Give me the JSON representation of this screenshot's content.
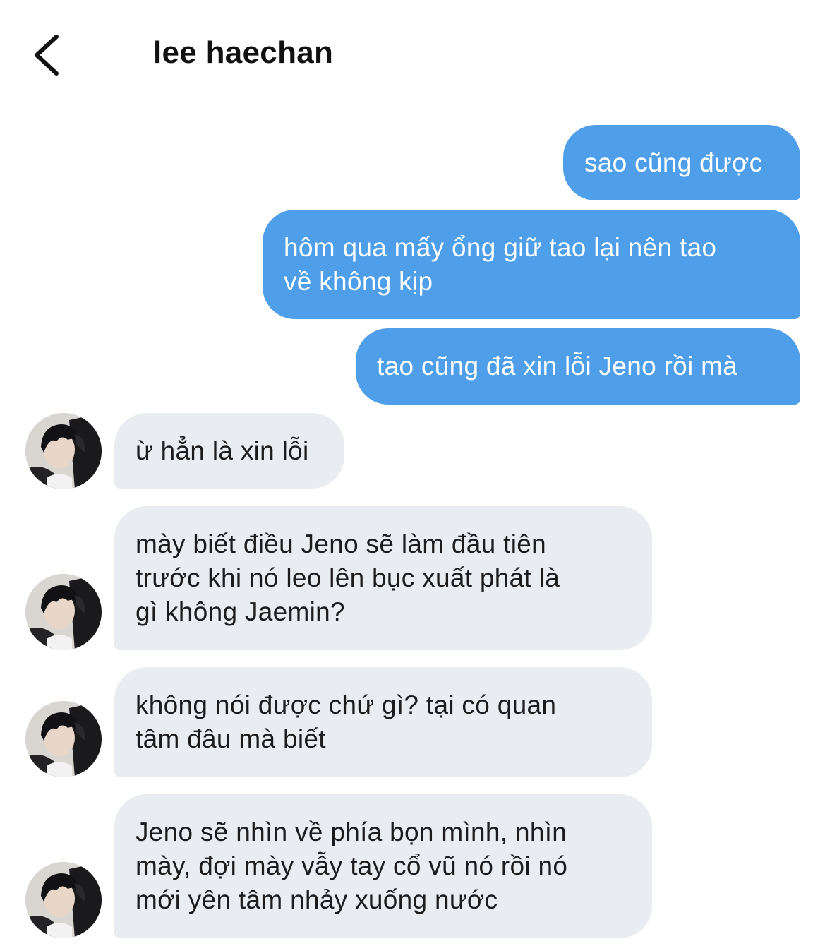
{
  "header": {
    "title": "lee haechan",
    "back_icon": "chevron-left-icon"
  },
  "colors": {
    "sent_bubble": "#4f9ee9",
    "received_bubble": "#e9ecf0",
    "sent_text": "#ffffff",
    "received_text": "#1c1c1e"
  },
  "messages": [
    {
      "direction": "sent",
      "text": "sao cũng được"
    },
    {
      "direction": "sent",
      "text": "hôm qua mấy ổng giữ tao lại nên tao\nvề không kịp"
    },
    {
      "direction": "sent",
      "text": "tao cũng đã xin lỗi Jeno rồi mà"
    },
    {
      "direction": "received",
      "text": "ừ hẳn là xin lỗi"
    },
    {
      "direction": "received",
      "text": "mày biết điều Jeno sẽ làm đầu tiên\ntrước khi nó leo lên bục xuất phát là\ngì không Jaemin?"
    },
    {
      "direction": "received",
      "text": "không nói được chứ gì? tại có quan\ntâm đâu mà biết"
    },
    {
      "direction": "received",
      "text": "Jeno sẽ nhìn về phía bọn mình, nhìn\nmày, đợi mày vẫy tay cổ vũ nó rồi nó\nmới yên tâm nhảy xuống nước"
    }
  ]
}
